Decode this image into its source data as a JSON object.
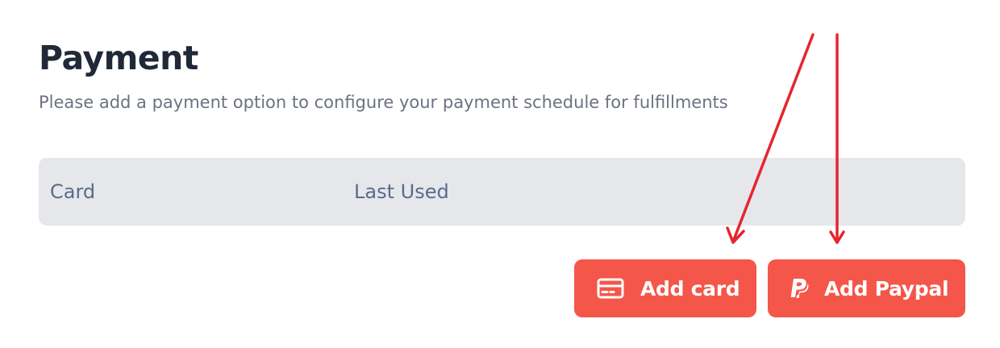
{
  "header": {
    "title": "Payment",
    "subtitle": "Please add a payment option to configure your payment schedule for fulfillments"
  },
  "table": {
    "columns": [
      "Card",
      "Last Used"
    ]
  },
  "actions": {
    "add_card_label": "Add card",
    "add_card_icon": "credit-card-icon",
    "add_paypal_label": "Add Paypal",
    "add_paypal_icon": "paypal-icon"
  },
  "colors": {
    "accent": "#f4564a",
    "annotation_arrow": "#e5262e",
    "table_header_bg": "#e5e7eb",
    "title_text": "#1f2937",
    "muted_text": "#6b7280",
    "column_text": "#5b6b8c"
  }
}
